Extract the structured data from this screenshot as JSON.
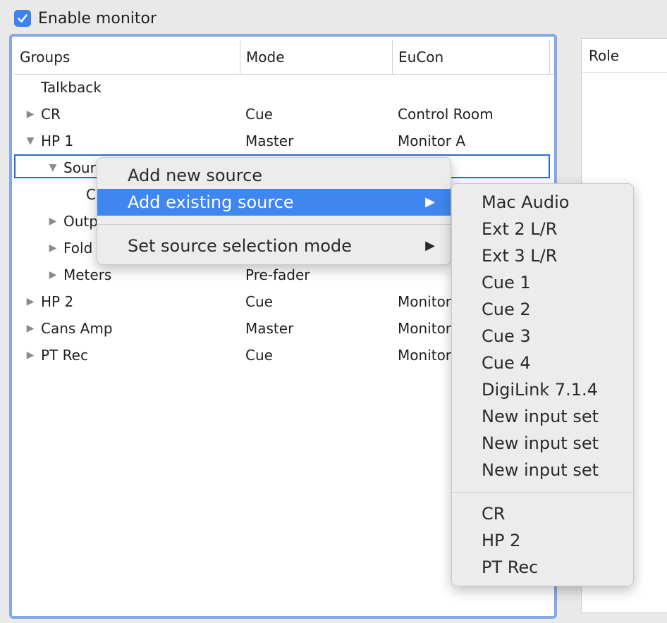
{
  "enable_monitor": {
    "label": "Enable monitor",
    "checked": true
  },
  "tree": {
    "columns": [
      "Groups",
      "Mode",
      "EuCon"
    ],
    "rows": [
      {
        "group": "Talkback",
        "mode": "",
        "eucon": ""
      },
      {
        "group": "CR",
        "mode": "Cue",
        "eucon": "Control Room"
      },
      {
        "group": "HP 1",
        "mode": "Master",
        "eucon": "Monitor A"
      },
      {
        "group": "Sour",
        "mode": "",
        "eucon": ""
      },
      {
        "group": "C",
        "mode": "",
        "eucon": ""
      },
      {
        "group": "Outp",
        "mode": "",
        "eucon": ""
      },
      {
        "group": "Fold",
        "mode": "",
        "eucon": ""
      },
      {
        "group": "Meters",
        "mode": "Pre-fader",
        "eucon": ""
      },
      {
        "group": "HP 2",
        "mode": "Cue",
        "eucon": "Monitor"
      },
      {
        "group": "Cans Amp",
        "mode": "Master",
        "eucon": "Monitor"
      },
      {
        "group": "PT Rec",
        "mode": "Cue",
        "eucon": "Monitor"
      }
    ]
  },
  "role_panel": {
    "header": "Role"
  },
  "context_menu": {
    "items": [
      {
        "label": "Add new source"
      },
      {
        "label": "Add existing source",
        "arrow": "▶"
      },
      {
        "label": "Set source selection mode",
        "arrow": "▶"
      }
    ]
  },
  "submenu": {
    "items": [
      "Mac Audio",
      "Ext 2 L/R",
      "Ext 3 L/R",
      "Cue 1",
      "Cue 2",
      "Cue 3",
      "Cue 4",
      "DigiLink 7.1.4",
      "New input set",
      "New input set",
      "New input set"
    ],
    "items_after_separator": [
      "CR",
      "HP 2",
      "PT Rec"
    ]
  },
  "icons": {
    "expanded": "▼",
    "collapsed": "▶"
  },
  "colors": {
    "accent": "#3f86ef",
    "focus_border": "#86a8e8",
    "selection_border": "#2c6bd6"
  }
}
